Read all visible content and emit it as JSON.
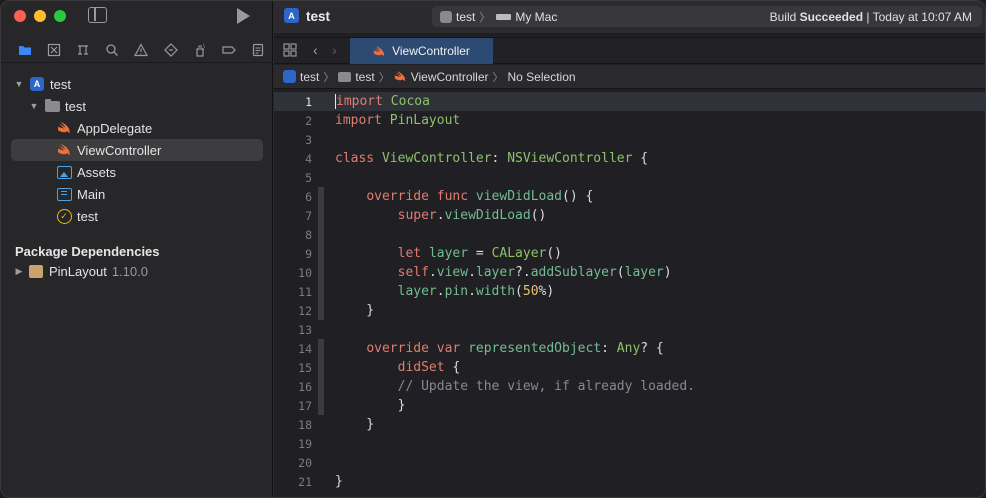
{
  "window": {
    "project_title": "test",
    "scheme_target": "test",
    "scheme_destination": "My Mac",
    "build_status_prefix": "Build ",
    "build_status_result": "Succeeded",
    "build_status_time": " | Today at 10:07 AM"
  },
  "sidebar": {
    "nav_tabs": [
      "folder-icon",
      "source-control-icon",
      "symbol-icon",
      "search-icon",
      "issue-icon",
      "test-icon",
      "debug-icon",
      "breakpoint-icon",
      "report-icon"
    ],
    "tree": [
      {
        "label": "test",
        "icon": "project-icon",
        "level": 0,
        "expanded": true
      },
      {
        "label": "test",
        "icon": "folder-icon",
        "level": 1,
        "expanded": true
      },
      {
        "label": "AppDelegate",
        "icon": "swift-icon",
        "level": 2
      },
      {
        "label": "ViewController",
        "icon": "swift-icon",
        "level": 2,
        "selected": true
      },
      {
        "label": "Assets",
        "icon": "asset-catalog-icon",
        "level": 2
      },
      {
        "label": "Main",
        "icon": "storyboard-icon",
        "level": 2
      },
      {
        "label": "test",
        "icon": "entitlements-icon",
        "level": 2
      }
    ],
    "package_section_title": "Package Dependencies",
    "package": {
      "name": "PinLayout",
      "version": "1.10.0"
    }
  },
  "editor": {
    "tab_label": "ViewController",
    "jumpbar": {
      "project": "test",
      "folder": "test",
      "file": "ViewController",
      "symbol": "No Selection"
    },
    "current_line": 1,
    "lines": [
      {
        "n": "1",
        "text": "import Cocoa"
      },
      {
        "n": "2",
        "text": "import PinLayout"
      },
      {
        "n": "3",
        "text": ""
      },
      {
        "n": "4",
        "text": "class ViewController: NSViewController {"
      },
      {
        "n": "5",
        "text": ""
      },
      {
        "n": "6",
        "text": "    override func viewDidLoad() {"
      },
      {
        "n": "7",
        "text": "        super.viewDidLoad()"
      },
      {
        "n": "8",
        "text": ""
      },
      {
        "n": "9",
        "text": "        let layer = CALayer()"
      },
      {
        "n": "10",
        "text": "        self.view.layer?.addSublayer(layer)"
      },
      {
        "n": "11",
        "text": "        layer.pin.width(50%)"
      },
      {
        "n": "12",
        "text": "    }"
      },
      {
        "n": "13",
        "text": ""
      },
      {
        "n": "14",
        "text": "    override var representedObject: Any? {"
      },
      {
        "n": "15",
        "text": "        didSet {"
      },
      {
        "n": "16",
        "text": "        // Update the view, if already loaded."
      },
      {
        "n": "17",
        "text": "        }"
      },
      {
        "n": "18",
        "text": "    }"
      },
      {
        "n": "19",
        "text": ""
      },
      {
        "n": "20",
        "text": ""
      },
      {
        "n": "21",
        "text": "}"
      }
    ]
  },
  "colors": {
    "keyword": "#e27c6f",
    "type": "#8ec26b",
    "function": "#73bd8f",
    "comment": "#848a93",
    "number": "#e7c46b",
    "selection": "#3d3d40",
    "tab_active": "#2d4a73"
  }
}
